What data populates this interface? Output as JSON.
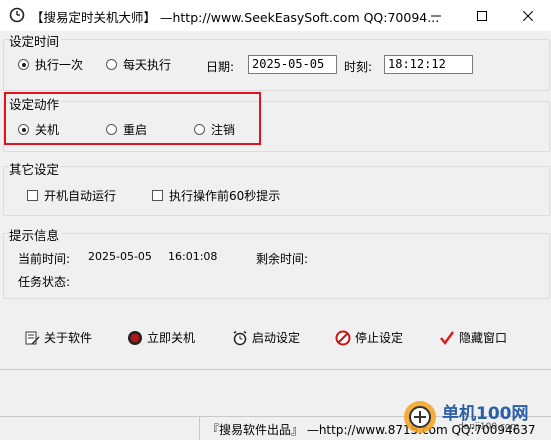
{
  "window": {
    "title": "【搜易定时关机大师】 —http://www.SeekEasySoft.com QQ:70094...",
    "controls": [
      "minimize-icon",
      "maximize-icon",
      "close-icon"
    ]
  },
  "time_group": {
    "title": "设定时间",
    "radio_once": "执行一次",
    "radio_daily": "每天执行",
    "selected": "执行一次",
    "date_label": "日期:",
    "date_value": "2025-05-05",
    "time_label": "时刻:",
    "time_value": "18:12:12"
  },
  "action_group": {
    "title": "设定动作",
    "options": [
      "关机",
      "重启",
      "注销"
    ],
    "selected": "关机"
  },
  "other_group": {
    "title": "其它设定",
    "check_autostart": "开机自动运行",
    "check_prompt": "执行操作前60秒提示"
  },
  "info_group": {
    "title": "提示信息",
    "current_time_label": "当前时间:",
    "current_date": "2025-05-05",
    "current_time": "16:01:08",
    "remaining_label": "剩余时间:",
    "task_status_label": "任务状态:"
  },
  "toolbar": {
    "about": "关于软件",
    "shutdown_now": "立即关机",
    "start": "启动设定",
    "stop": "停止设定",
    "hide": "隐藏窗口"
  },
  "statusbar": {
    "text": "『搜易软件出品』 —http://www.8715.com   QQ:70094637"
  },
  "watermark": {
    "text": "单机100网",
    "url": "danji100.com"
  },
  "colors": {
    "highlight": "#e0141e",
    "check_red": "#d81e1e"
  }
}
